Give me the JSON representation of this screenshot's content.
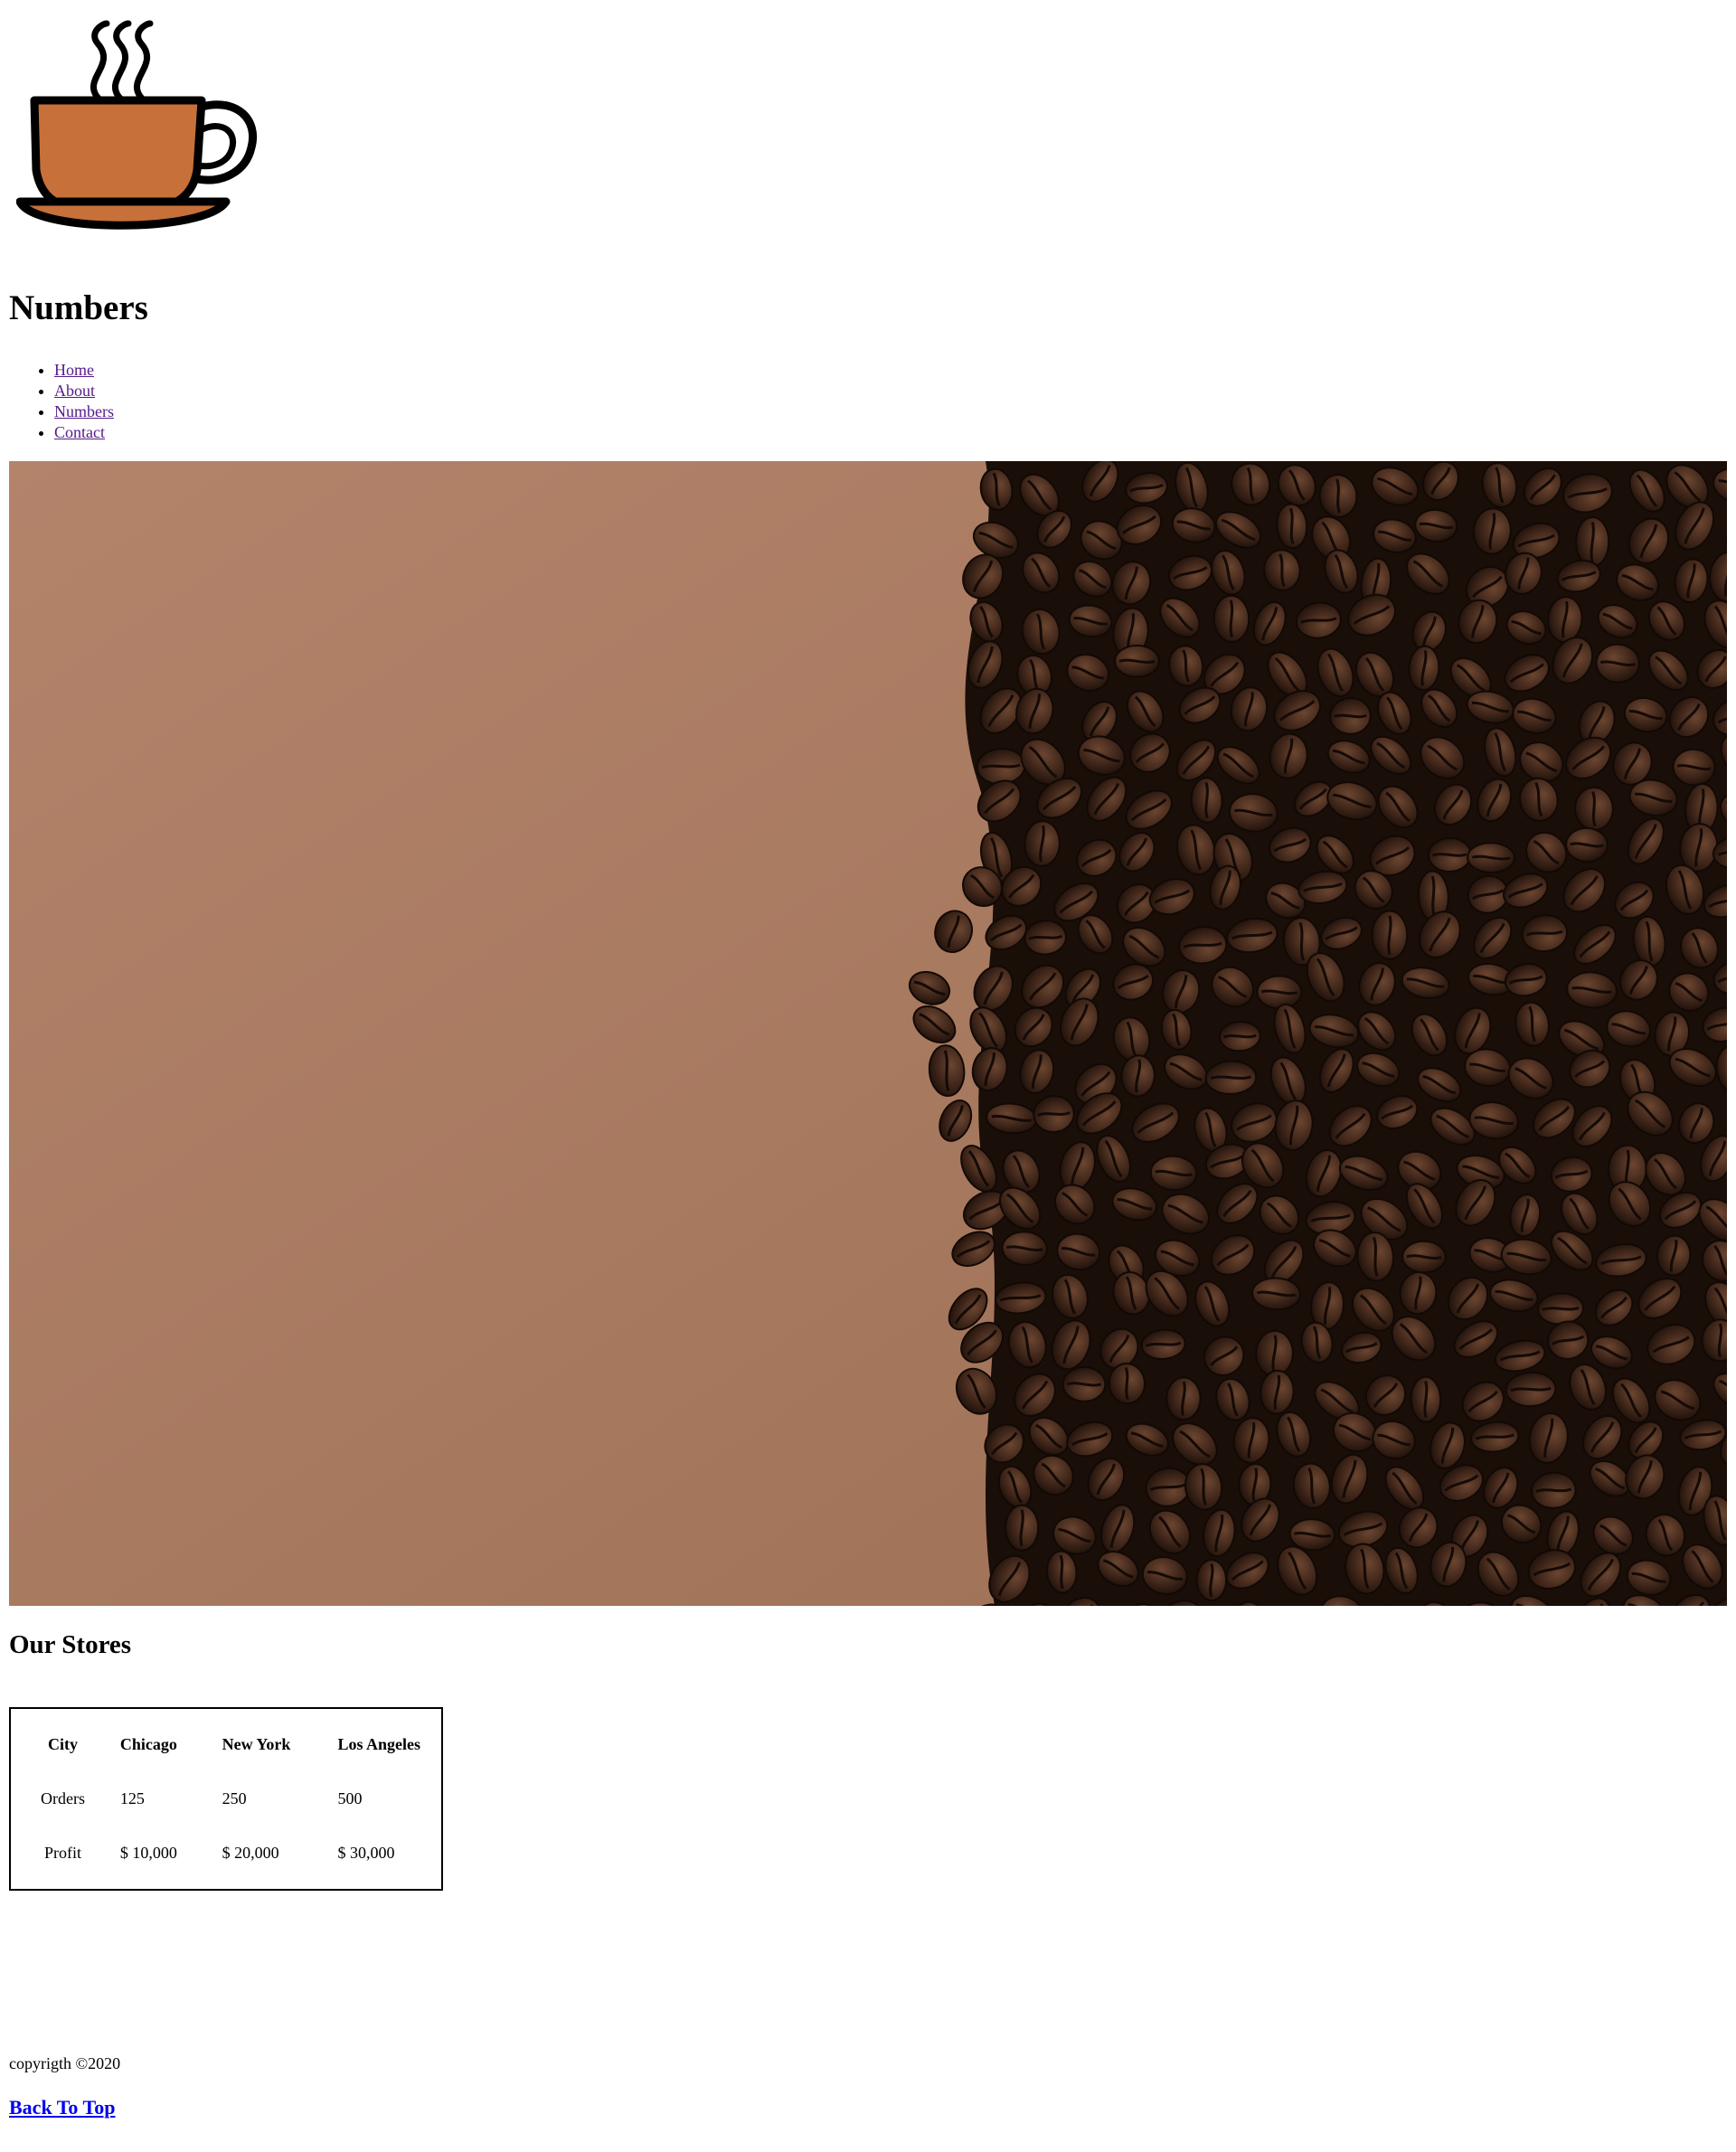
{
  "header": {
    "logo_icon": "coffee-cup-icon",
    "title": "Numbers"
  },
  "nav": {
    "items": [
      {
        "label": "Home"
      },
      {
        "label": "About"
      },
      {
        "label": "Numbers"
      },
      {
        "label": "Contact"
      }
    ]
  },
  "hero": {
    "image": "coffee-beans-photo"
  },
  "stores": {
    "title": "Our Stores",
    "table": {
      "headers": [
        "City",
        "Chicago",
        "New York",
        "Los Angeles"
      ],
      "rows": [
        [
          "Orders",
          "125",
          "250",
          "500"
        ],
        [
          "Profit",
          "$ 10,000",
          "$ 20,000",
          "$ 30,000"
        ]
      ]
    }
  },
  "footer": {
    "copyright": "copyrigth ©2020",
    "back_to_top": "Back To Top"
  },
  "colors": {
    "cup_fill": "#c8703a",
    "link_visited": "#551a8b",
    "link": "#0000ee",
    "hero_background": "#b08068",
    "beans": "#3a2218"
  }
}
